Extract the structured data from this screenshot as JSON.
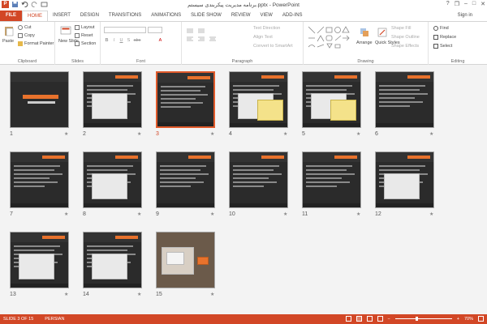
{
  "window": {
    "title": "برنامه مدیریت پیکربندی سیستم.pptx - PowerPoint",
    "minimize": "–",
    "maximize": "□",
    "close": "✕",
    "help": "?",
    "restore": "❐",
    "sign_in": "Sign in"
  },
  "tabs": [
    "FILE",
    "HOME",
    "INSERT",
    "DESIGN",
    "TRANSITIONS",
    "ANIMATIONS",
    "SLIDE SHOW",
    "REVIEW",
    "VIEW",
    "ADD-INS"
  ],
  "active_tab": "HOME",
  "ribbon": {
    "clipboard": {
      "paste": "Paste",
      "cut": "Cut",
      "copy": "Copy",
      "format_painter": "Format Painter",
      "label": "Clipboard"
    },
    "slides": {
      "new_slide": "New Slide",
      "layout": "Layout",
      "reset": "Reset",
      "section": "Section",
      "label": "Slides"
    },
    "font": {
      "label": "Font",
      "bold": "B",
      "italic": "I",
      "underline": "U",
      "shadow": "S",
      "strike": "abc",
      "font_color": "A"
    },
    "paragraph": {
      "text_direction": "Text Direction",
      "align_text": "Align Text",
      "convert_smartart": "Convert to SmartArt",
      "label": "Paragraph"
    },
    "drawing": {
      "arrange": "Arrange",
      "quick_styles": "Quick Styles",
      "shape_fill": "Shape Fill",
      "shape_outline": "Shape Outline",
      "shape_effects": "Shape Effects",
      "label": "Drawing"
    },
    "editing": {
      "find": "Find",
      "replace": "Replace",
      "select": "Select",
      "label": "Editing"
    }
  },
  "slides": [
    {
      "number": "1",
      "star": "★",
      "kind": "title"
    },
    {
      "number": "2",
      "star": "★",
      "kind": "screenshot"
    },
    {
      "number": "3",
      "star": "★",
      "kind": "text",
      "selected": true
    },
    {
      "number": "4",
      "star": "★",
      "kind": "screenshot-note"
    },
    {
      "number": "5",
      "star": "★",
      "kind": "screenshot-note"
    },
    {
      "number": "6",
      "star": "★",
      "kind": "text"
    },
    {
      "number": "7",
      "star": "★",
      "kind": "text"
    },
    {
      "number": "8",
      "star": "★",
      "kind": "screenshot"
    },
    {
      "number": "9",
      "star": "★",
      "kind": "text"
    },
    {
      "number": "10",
      "star": "★",
      "kind": "text"
    },
    {
      "number": "11",
      "star": "★",
      "kind": "text"
    },
    {
      "number": "12",
      "star": "★",
      "kind": "screenshot"
    },
    {
      "number": "13",
      "star": "★",
      "kind": "screenshot"
    },
    {
      "number": "14",
      "star": "★",
      "kind": "screenshot"
    },
    {
      "number": "15",
      "star": "★",
      "kind": "photo"
    }
  ],
  "status": {
    "slide_info": "SLIDE 3 OF 15",
    "language": "PERSIAN",
    "zoom": "70%",
    "zoom_level": 0.7
  },
  "colors": {
    "accent": "#d24726",
    "slide_bg": "#2b2b2b",
    "slide_title": "#e8722c"
  }
}
